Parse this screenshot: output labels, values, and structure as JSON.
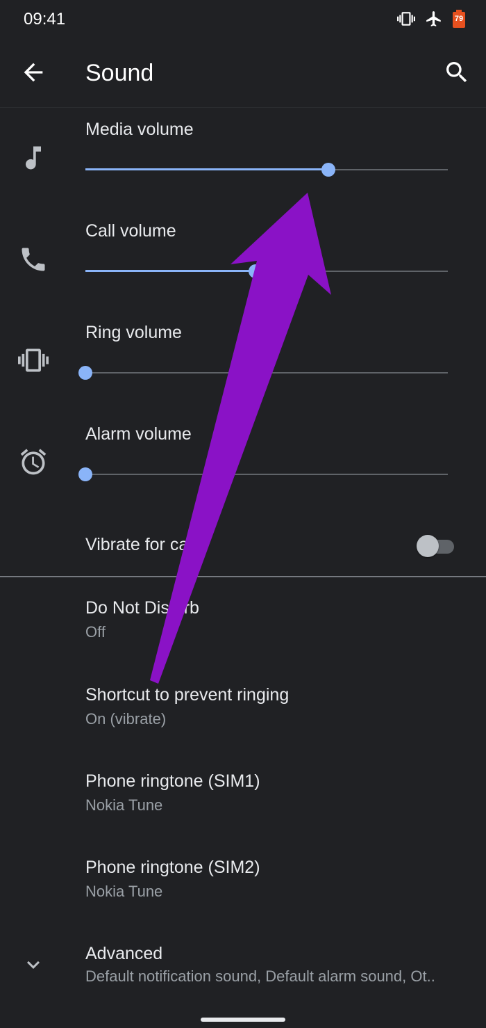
{
  "status_bar": {
    "time": "09:41",
    "battery_level": "79",
    "icons": [
      "vibrate-icon",
      "airplane-icon",
      "battery-icon"
    ]
  },
  "app_bar": {
    "title": "Sound",
    "back_icon": "arrow-back-icon",
    "search_icon": "search-icon"
  },
  "volumes": [
    {
      "label": "Media volume",
      "icon": "music-note-icon",
      "level": 0.67
    },
    {
      "label": "Call volume",
      "icon": "phone-icon",
      "level": 0.47
    },
    {
      "label": "Ring volume",
      "icon": "vibrate-icon",
      "level": 0.0
    },
    {
      "label": "Alarm volume",
      "icon": "alarm-icon",
      "level": 0.0
    }
  ],
  "vibrate_for_calls": {
    "label": "Vibrate for calls",
    "enabled": false
  },
  "preferences": [
    {
      "title": "Do Not Disturb",
      "summary": "Off"
    },
    {
      "title": "Shortcut to prevent ringing",
      "summary": "On (vibrate)"
    },
    {
      "title": "Phone ringtone (SIM1)",
      "summary": "Nokia Tune"
    },
    {
      "title": "Phone ringtone (SIM2)",
      "summary": "Nokia Tune"
    }
  ],
  "advanced": {
    "title": "Advanced",
    "summary": "Default notification sound, Default alarm sound, Ot..",
    "icon": "chevron-down-icon"
  },
  "colors": {
    "background": "#202124",
    "accent": "#8ab4f8",
    "annotation_arrow": "#8a12c6"
  }
}
